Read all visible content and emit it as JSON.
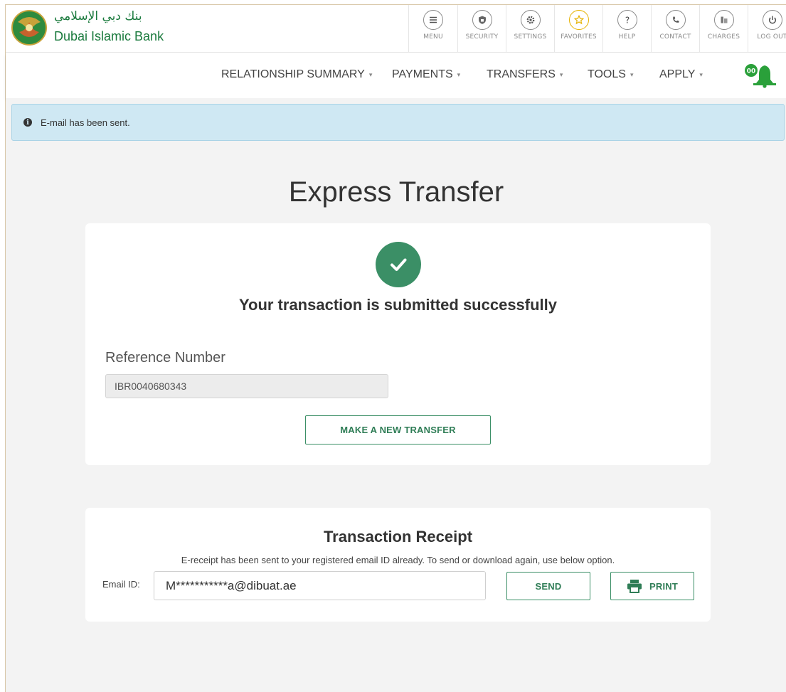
{
  "header": {
    "brand_ar": "بنك دبي الإسلامي",
    "brand_en": "Dubai Islamic Bank",
    "tools": [
      {
        "label": "MENU",
        "icon": "menu-icon"
      },
      {
        "label": "SECURITY",
        "icon": "shield-icon"
      },
      {
        "label": "SETTINGS",
        "icon": "gear-icon"
      },
      {
        "label": "FAVORITES",
        "icon": "star-icon"
      },
      {
        "label": "HELP",
        "icon": "help-icon"
      },
      {
        "label": "CONTACT",
        "icon": "phone-icon"
      },
      {
        "label": "CHARGES",
        "icon": "charges-icon"
      },
      {
        "label": "LOG OUT",
        "icon": "power-icon"
      }
    ]
  },
  "nav": {
    "items": [
      {
        "label": "RELATIONSHIP SUMMARY"
      },
      {
        "label": "PAYMENTS"
      },
      {
        "label": "TRANSFERS"
      },
      {
        "label": "TOOLS"
      },
      {
        "label": "APPLY"
      }
    ],
    "bell_badge": "00"
  },
  "alert": {
    "message": "E-mail has been sent."
  },
  "page": {
    "title": "Express Transfer"
  },
  "result": {
    "message": "Your transaction is submitted successfully",
    "reference_label": "Reference Number",
    "reference_value": "IBR0040680343",
    "new_transfer_label": "MAKE A NEW TRANSFER"
  },
  "receipt": {
    "title": "Transaction Receipt",
    "note": "E-receipt has been sent to your registered email ID already. To send or download again, use below option.",
    "email_label": "Email ID:",
    "email_value": "M***********a@dibuat.ae",
    "send_label": "SEND",
    "print_label": "PRINT"
  },
  "colors": {
    "brand_green": "#1a7a3d",
    "success_green": "#3b8f66",
    "alert_bg": "#cfe8f3",
    "favorites_gold": "#e6b200"
  }
}
